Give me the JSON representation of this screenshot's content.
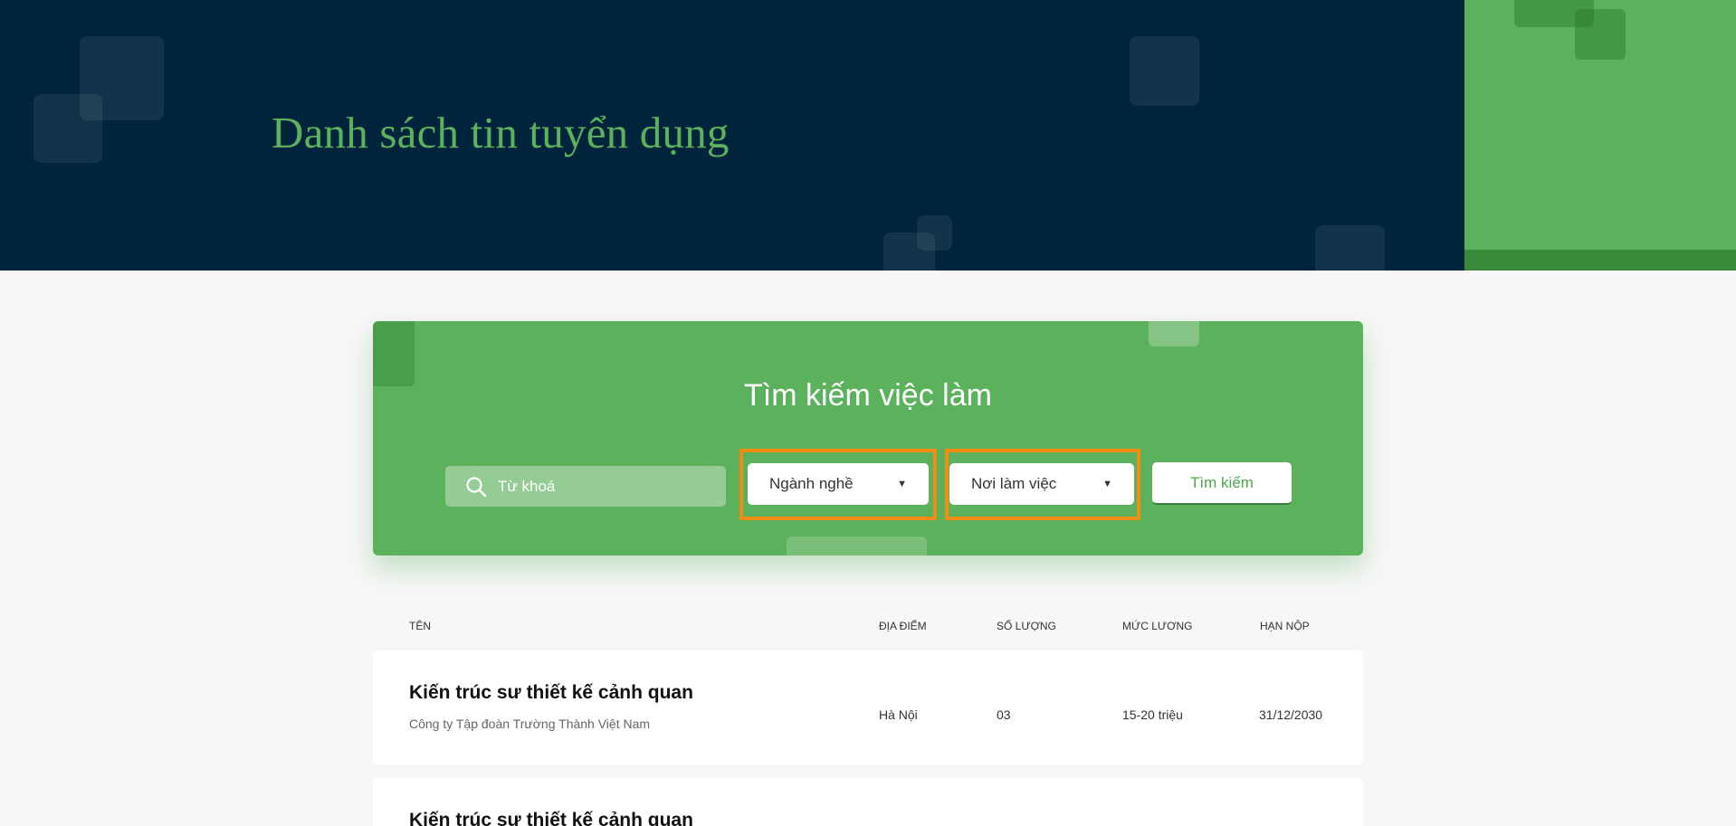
{
  "header": {
    "title": "Danh sách tin tuyển dụng"
  },
  "search": {
    "title": "Tìm kiếm việc làm",
    "keyword_placeholder": "Từ khoá",
    "category_value": "Ngành nghề",
    "location_value": "Nơi làm việc",
    "submit_label": "Tìm kiếm"
  },
  "table": {
    "headers": [
      "TÊN",
      "ĐỊA ĐIỂM",
      "SỐ LƯỢNG",
      "MỨC LƯƠNG",
      "HẠN NỘP"
    ],
    "rows": [
      {
        "title": "Kiến trúc sư thiết kế cảnh quan",
        "company": "Công ty Tập đoàn Trường Thành Việt Nam",
        "location": "Hà Nội",
        "quantity": "03",
        "salary": "15-20 triệu",
        "deadline": "31/12/2030"
      },
      {
        "title": "Kiến trúc sư thiết kế cảnh quan"
      }
    ]
  },
  "colors": {
    "hero_background": "#00243c",
    "brand_green": "#5cb15d",
    "highlight_orange": "#f28c13"
  },
  "icons": {
    "keyword_search": "search-icon",
    "dropdown": "caret-down-icon"
  }
}
